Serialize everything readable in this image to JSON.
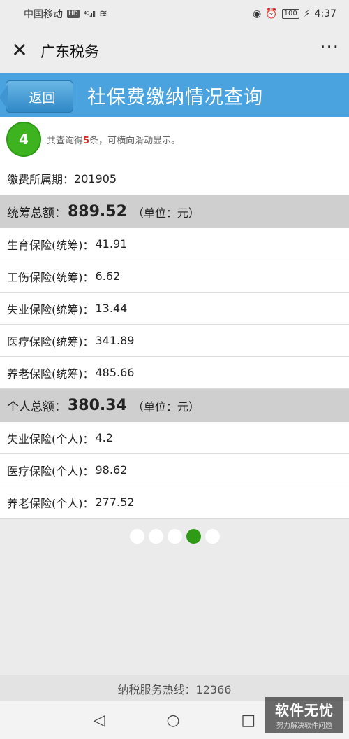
{
  "status_bar": {
    "carrier": "中国移动",
    "hd": "HD",
    "signal": "⁴ᴳ.ıll",
    "battery": "100",
    "time": "4:37"
  },
  "title_bar": {
    "app_title": "广东税务"
  },
  "header": {
    "back_label": "返回",
    "page_title": "社保费缴纳情况查询"
  },
  "summary": {
    "index": "4",
    "prefix": "共查询得",
    "count": "5",
    "suffix": "条，可横向滑动显示。"
  },
  "period": {
    "label": "缴费所属期：",
    "value": "201905"
  },
  "pooled": {
    "label": "统筹总额：",
    "value": "889.52",
    "unit": "（单位：元）",
    "items": [
      {
        "label": "生育保险(统筹)：",
        "value": "41.91"
      },
      {
        "label": "工伤保险(统筹)：",
        "value": "6.62"
      },
      {
        "label": "失业保险(统筹)：",
        "value": "13.44"
      },
      {
        "label": "医疗保险(统筹)：",
        "value": "341.89"
      },
      {
        "label": "养老保险(统筹)：",
        "value": "485.66"
      }
    ]
  },
  "personal": {
    "label": "个人总额：",
    "value": "380.34",
    "unit": "（单位：元）",
    "items": [
      {
        "label": "失业保险(个人)：",
        "value": "4.2"
      },
      {
        "label": "医疗保险(个人)：",
        "value": "98.62"
      },
      {
        "label": "养老保险(个人)：",
        "value": "277.52"
      }
    ]
  },
  "pager": {
    "total": 5,
    "active_index": 4
  },
  "footer": {
    "hotline": "纳税服务热线：12366"
  },
  "watermark": {
    "title": "软件无忧",
    "subtitle": "努力解决软件问题"
  },
  "colors": {
    "accent_blue": "#4aa3df",
    "accent_green": "#3cb31f",
    "highlight_red": "#d32f2f"
  }
}
